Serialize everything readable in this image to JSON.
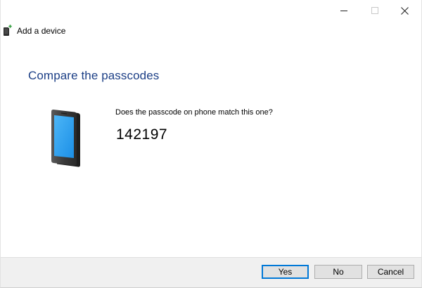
{
  "window": {
    "title": "Add a device",
    "controls": {
      "minimize_icon": "minimize-icon",
      "maximize_icon": "maximize-icon",
      "close_icon": "close-icon"
    }
  },
  "main": {
    "heading": "Compare the passcodes",
    "question": "Does the passcode on phone match this one?",
    "passcode": "142197",
    "illustration": "phone-icon"
  },
  "footer": {
    "yes_label": "Yes",
    "no_label": "No",
    "cancel_label": "Cancel"
  },
  "colors": {
    "heading": "#1c3f86",
    "default_button_border": "#0078d7",
    "footer_background": "#f0f0f0",
    "phone_screen": "#2aa3f3"
  }
}
